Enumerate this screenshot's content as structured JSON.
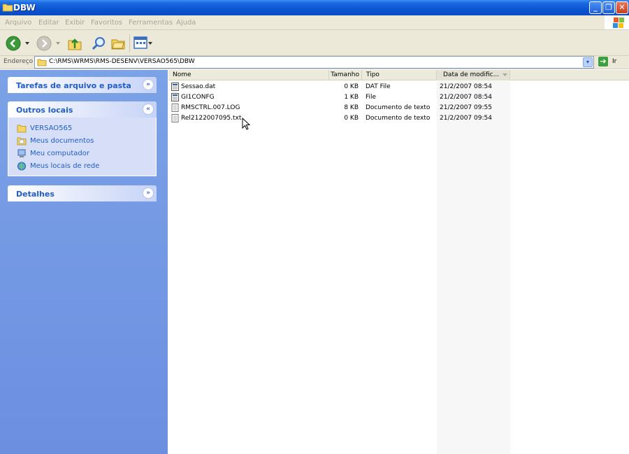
{
  "window": {
    "title": "DBW"
  },
  "menu": [
    "Arquivo",
    "Editar",
    "Exibir",
    "Favoritos",
    "Ferramentas",
    "Ajuda"
  ],
  "address": {
    "label": "Endereço",
    "path": "C:\\RMS\\WRMS\\RMS-DESENV\\VERSAO565\\DBW",
    "go_label": "Ir"
  },
  "taskpane": {
    "file_tasks_title": "Tarefas de arquivo e pasta",
    "other_places_title": "Outros locais",
    "other_places": [
      {
        "label": "VERSAO565",
        "icon": "folder-icon"
      },
      {
        "label": "Meus documentos",
        "icon": "my-documents-icon"
      },
      {
        "label": "Meu computador",
        "icon": "my-computer-icon"
      },
      {
        "label": "Meus locais de rede",
        "icon": "network-places-icon"
      }
    ],
    "details_title": "Detalhes"
  },
  "columns": {
    "name": "Nome",
    "size": "Tamanho",
    "type": "Tipo",
    "date": "Data de modific..."
  },
  "files": [
    {
      "name": "Sessao.dat",
      "size": "0 KB",
      "type": "DAT File",
      "date": "21/2/2007 08:54",
      "icon": "data-file-icon"
    },
    {
      "name": "GI1CONFG",
      "size": "1 KB",
      "type": "File",
      "date": "21/2/2007 08:54",
      "icon": "data-file-icon"
    },
    {
      "name": "RMSCTRL.007.LOG",
      "size": "8 KB",
      "type": "Documento de texto",
      "date": "21/2/2007 09:55",
      "icon": "text-file-icon"
    },
    {
      "name": "Rel2122007095.txt",
      "size": "0 KB",
      "type": "Documento de texto",
      "date": "21/2/2007 09:54",
      "icon": "text-file-icon"
    }
  ]
}
